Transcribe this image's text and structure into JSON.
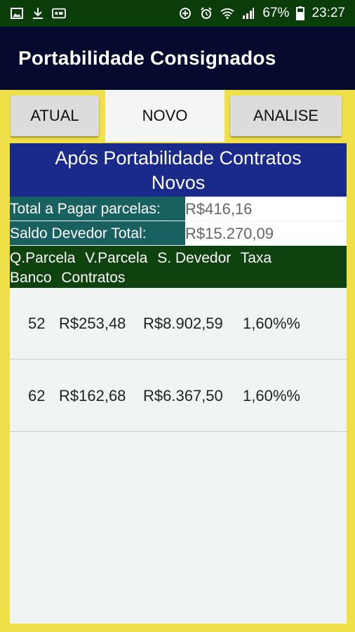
{
  "status_bar": {
    "battery": "67%",
    "time": "23:27",
    "icons_left": [
      "image-icon",
      "download-icon",
      "gif-icon"
    ],
    "icons_right": [
      "data-saver-icon",
      "alarm-icon",
      "wifi-icon",
      "signal-icon",
      "battery-icon"
    ]
  },
  "app_bar": {
    "title": "Portabilidade Consignados"
  },
  "tabs": [
    {
      "label": "ATUAL"
    },
    {
      "label": "NOVO",
      "selected": true
    },
    {
      "label": "ANALISE"
    }
  ],
  "panel": {
    "heading_line1": "Após Portabilidade Contratos",
    "heading_line2": "Novos",
    "summary": {
      "total_label": "Total a Pagar parcelas:",
      "total_value": "R$416,16",
      "saldo_label": "Saldo Devedor Total:",
      "saldo_value": "R$15.270,09"
    },
    "columns": [
      "Q.Parcela",
      "V.Parcela",
      "S. Devedor",
      "Taxa",
      "Banco",
      "Contratos"
    ],
    "rows": [
      {
        "qtd": "52",
        "valor": "R$253,48",
        "saldo": "R$8.902,59",
        "taxa": "1,60%%"
      },
      {
        "qtd": "62",
        "valor": "R$162,68",
        "saldo": "R$6.367,50",
        "taxa": "1,60%%"
      }
    ]
  },
  "colors": {
    "status_bar": "#0b3d0b",
    "app_bar": "#050a2e",
    "background": "#efe04a",
    "heading": "#1a2a8a",
    "summary_label": "#196060",
    "column_header": "#0e420e"
  }
}
